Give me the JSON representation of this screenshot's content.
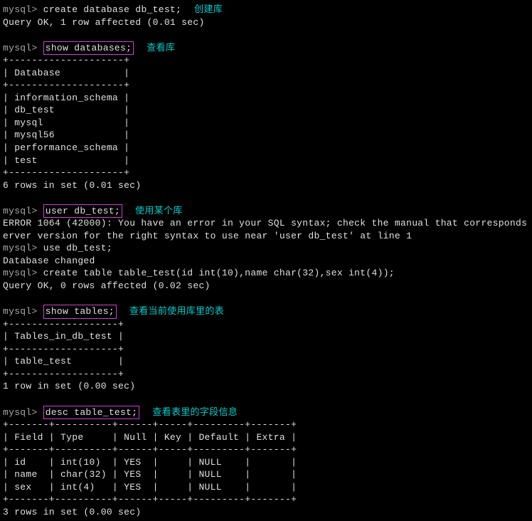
{
  "l1_prompt": "mysql> ",
  "l1_cmd": "create database db_test;",
  "annot_create": "创建库",
  "l2": "Query OK, 1 row affected (0.01 sec)",
  "blank": "",
  "l3_prompt": "mysql> ",
  "l3_cmd": "show databases;",
  "annot_showdb": "查看库",
  "tbl1_sep": "+--------------------+",
  "tbl1_hdr": "| Database           |",
  "tbl1_r1": "| information_schema |",
  "tbl1_r2": "| db_test            |",
  "tbl1_r3": "| mysql              |",
  "tbl1_r4": "| mysql56            |",
  "tbl1_r5": "| performance_schema |",
  "tbl1_r6": "| test               |",
  "tbl1_foot": "6 rows in set (0.01 sec)",
  "l4_prompt": "mysql> ",
  "l4_cmd": "user db_test;",
  "annot_usedb": "使用某个库",
  "err1": "ERROR 1064 (42000): You have an error in your SQL syntax; check the manual that corresponds ",
  "err2": "erver version for the right syntax to use near 'user db_test' at line 1",
  "l5_prompt": "mysql> ",
  "l5_cmd": "use db_test;",
  "l6": "Database changed",
  "l7_prompt": "mysql> ",
  "l7_cmd": "create table table_test(id int(10),name char(32),sex int(4));",
  "l8": "Query OK, 0 rows affected (0.02 sec)",
  "l9_prompt": "mysql> ",
  "l9_cmd": "show tables;",
  "annot_showtbl": "查看当前使用库里的表",
  "tbl2_sep": "+-------------------+",
  "tbl2_hdr": "| Tables_in_db_test |",
  "tbl2_r1": "| table_test        |",
  "tbl2_foot": "1 row in set (0.00 sec)",
  "l10_prompt": "mysql> ",
  "l10_cmd": "desc table_test;",
  "annot_desc": "查看表里的字段信息",
  "tbl3_sep": "+-------+----------+------+-----+---------+-------+",
  "tbl3_hdr": "| Field | Type     | Null | Key | Default | Extra |",
  "tbl3_r1": "| id    | int(10)  | YES  |     | NULL    |       |",
  "tbl3_r2": "| name  | char(32) | YES  |     | NULL    |       |",
  "tbl3_r3": "| sex   | int(4)   | YES  |     | NULL    |       |",
  "tbl3_foot": "3 rows in set (0.00 sec)"
}
